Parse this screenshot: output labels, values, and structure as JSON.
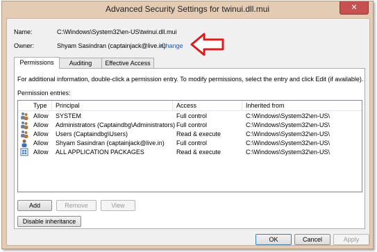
{
  "window": {
    "title": "Advanced Security Settings for twinui.dll.mui",
    "close_glyph": "✕",
    "minimize_glyph": "—",
    "maximize_glyph": "☐"
  },
  "info": {
    "name_label": "Name:",
    "name_value": "C:\\Windows\\System32\\en-US\\twinui.dll.mui",
    "owner_label": "Owner:",
    "owner_value": "Shyam Sasindran (captainjack@live.in)",
    "change_link": "Change"
  },
  "tabs": [
    {
      "label": "Permissions",
      "active": true
    },
    {
      "label": "Auditing",
      "active": false
    },
    {
      "label": "Effective Access",
      "active": false
    }
  ],
  "panel": {
    "instructions": "For additional information, double-click a permission entry. To modify permissions, select the entry and click Edit (if available).",
    "entries_label": "Permission entries:",
    "columns": [
      "Type",
      "Principal",
      "Access",
      "Inherited from"
    ],
    "rows": [
      {
        "type": "Allow",
        "principal": "SYSTEM",
        "access": "Full control",
        "inherited": "C:\\Windows\\System32\\en-US\\",
        "icon": "group-icon"
      },
      {
        "type": "Allow",
        "principal": "Administrators (Captaindbg\\Administrators)",
        "access": "Full control",
        "inherited": "C:\\Windows\\System32\\en-US\\",
        "icon": "group-icon"
      },
      {
        "type": "Allow",
        "principal": "Users (Captaindbg\\Users)",
        "access": "Read & execute",
        "inherited": "C:\\Windows\\System32\\en-US\\",
        "icon": "group-icon"
      },
      {
        "type": "Allow",
        "principal": "Shyam Sasindran (captainjack@live.in)",
        "access": "Full control",
        "inherited": "C:\\Windows\\System32\\en-US\\",
        "icon": "user-icon"
      },
      {
        "type": "Allow",
        "principal": "ALL APPLICATION PACKAGES",
        "access": "Read & execute",
        "inherited": "C:\\Windows\\System32\\en-US\\",
        "icon": "package-icon"
      }
    ],
    "add_label": "Add",
    "remove_label": "Remove",
    "view_label": "View",
    "disable_inheritance_label": "Disable inheritance"
  },
  "footer": {
    "ok_label": "OK",
    "cancel_label": "Cancel",
    "apply_label": "Apply"
  },
  "colors": {
    "frame": "#e4ccb4",
    "close_button": "#c75050",
    "link": "#1a5fb4",
    "annotation_arrow": "#e01b1b"
  }
}
